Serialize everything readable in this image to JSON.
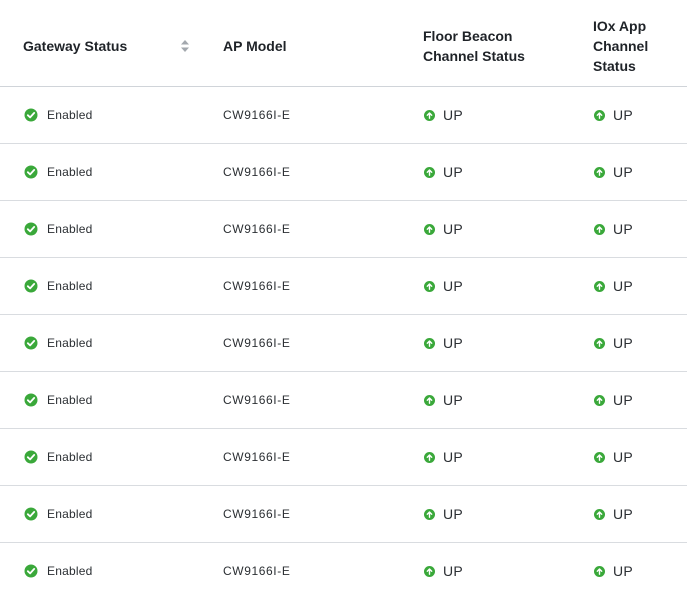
{
  "header": {
    "gateway_status": "Gateway Status",
    "ap_model": "AP Model",
    "floor_beacon_line1": "Floor Beacon",
    "floor_beacon_line2": "Channel Status",
    "iox_line1": "IOx App",
    "iox_line2": "Channel",
    "iox_line3": "Status",
    "sort_icon": "sort-up-down-icon"
  },
  "colors": {
    "status_green": "#3aa83a",
    "divider": "#d9dce0",
    "text": "#2b2f33"
  },
  "rows": [
    {
      "gateway_status": "Enabled",
      "ap_model": "CW9166I-E",
      "floor_beacon": "UP",
      "iox": "UP"
    },
    {
      "gateway_status": "Enabled",
      "ap_model": "CW9166I-E",
      "floor_beacon": "UP",
      "iox": "UP"
    },
    {
      "gateway_status": "Enabled",
      "ap_model": "CW9166I-E",
      "floor_beacon": "UP",
      "iox": "UP"
    },
    {
      "gateway_status": "Enabled",
      "ap_model": "CW9166I-E",
      "floor_beacon": "UP",
      "iox": "UP"
    },
    {
      "gateway_status": "Enabled",
      "ap_model": "CW9166I-E",
      "floor_beacon": "UP",
      "iox": "UP"
    },
    {
      "gateway_status": "Enabled",
      "ap_model": "CW9166I-E",
      "floor_beacon": "UP",
      "iox": "UP"
    },
    {
      "gateway_status": "Enabled",
      "ap_model": "CW9166I-E",
      "floor_beacon": "UP",
      "iox": "UP"
    },
    {
      "gateway_status": "Enabled",
      "ap_model": "CW9166I-E",
      "floor_beacon": "UP",
      "iox": "UP"
    },
    {
      "gateway_status": "Enabled",
      "ap_model": "CW9166I-E",
      "floor_beacon": "UP",
      "iox": "UP"
    }
  ]
}
